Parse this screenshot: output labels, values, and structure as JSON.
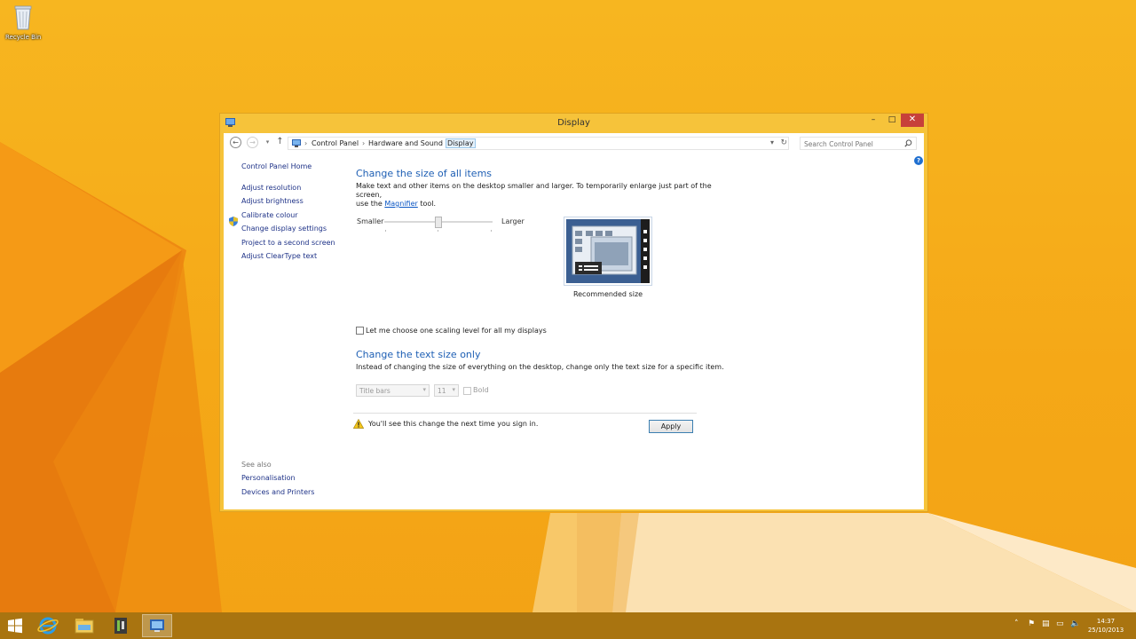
{
  "desktop": {
    "recycle_bin_label": "Recycle Bin"
  },
  "window": {
    "title": "Display",
    "controls": {
      "minimize": "–",
      "maximize": "□",
      "close": "✕"
    }
  },
  "address_bar": {
    "breadcrumbs": [
      "Control Panel",
      "Hardware and Sound",
      "Display"
    ],
    "search_placeholder": "Search Control Panel"
  },
  "left_nav": {
    "home": "Control Panel Home",
    "items": [
      "Adjust resolution",
      "Adjust brightness",
      "Calibrate colour",
      "Change display settings",
      "Project to a second screen",
      "Adjust ClearType text"
    ],
    "see_also_header": "See also",
    "see_also": [
      "Personalisation",
      "Devices and Printers"
    ]
  },
  "main": {
    "section1": {
      "title": "Change the size of all items",
      "desc_line1": "Make text and other items on the desktop smaller and larger. To temporarily enlarge just part of the screen,",
      "desc_pre": "use the ",
      "desc_link": "Magnifier",
      "desc_post": " tool.",
      "smaller": "Smaller",
      "larger": "Larger",
      "slider_level": 0.5,
      "preview_label": "Recommended size"
    },
    "scaling_checkbox": {
      "label": "Let me choose one scaling level for all my displays",
      "checked": false
    },
    "section2": {
      "title": "Change the text size only",
      "desc": "Instead of changing the size of everything on the desktop, change only the text size for a specific item.",
      "item_select": "Title bars",
      "size_select": "11",
      "bold_label": "Bold"
    },
    "warning_text": "You'll see this change the next time you sign in.",
    "apply_label": "Apply"
  },
  "taskbar": {
    "apps": [
      "start-icon",
      "internet-explorer-icon",
      "file-explorer-icon",
      "app-icon",
      "control-panel-icon"
    ],
    "time": "14:37",
    "date": "25/10/2013"
  },
  "colors": {
    "accent": "#1e5fb4",
    "link": "#1e3287",
    "window_frame": "#f6c33a",
    "close_button": "#c7403a"
  }
}
